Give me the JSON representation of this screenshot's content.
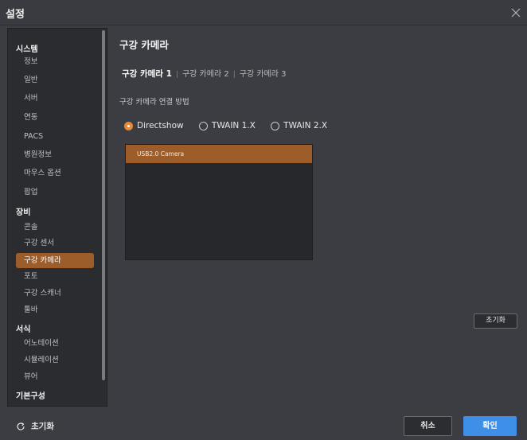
{
  "window": {
    "title": "설정"
  },
  "sidebar": {
    "groups": [
      {
        "label": "시스템",
        "items": [
          "정보",
          "일반",
          "서버",
          "연동",
          "PACS",
          "병원정보",
          "마우스 옵션",
          "팝업"
        ]
      },
      {
        "label": "장비",
        "items": [
          "콘솔",
          "구강 센서",
          "구강 카메라",
          "포토",
          "구강 스캐너",
          "툴바"
        ]
      },
      {
        "label": "서식",
        "items": [
          "어노테이션",
          "시뮬레이션",
          "뷰어"
        ]
      },
      {
        "label": "기본구성",
        "items": []
      }
    ],
    "active_item": "구강 카메라"
  },
  "main": {
    "title": "구강 카메라",
    "subtabs": [
      "구강 카메라 1",
      "구강 카메라 2",
      "구강 카메라 3"
    ],
    "active_subtab": "구강 카메라 1",
    "connection_label": "구강 카메라 연결 방법",
    "radio_options": [
      "Directshow",
      "TWAIN 1.X",
      "TWAIN 2.X"
    ],
    "selected_radio": "Directshow",
    "camera_list": [
      "USB2.0 Camera"
    ],
    "reset_button": "초기화"
  },
  "footer": {
    "reset_label": "초기화",
    "cancel_label": "취소",
    "ok_label": "확인"
  },
  "colors": {
    "accent": "#9c5d2a",
    "primary_button": "#3d8fe8",
    "radio_checked": "#e58a3a"
  },
  "icons": {
    "close": "close-icon",
    "reset": "refresh-icon"
  }
}
